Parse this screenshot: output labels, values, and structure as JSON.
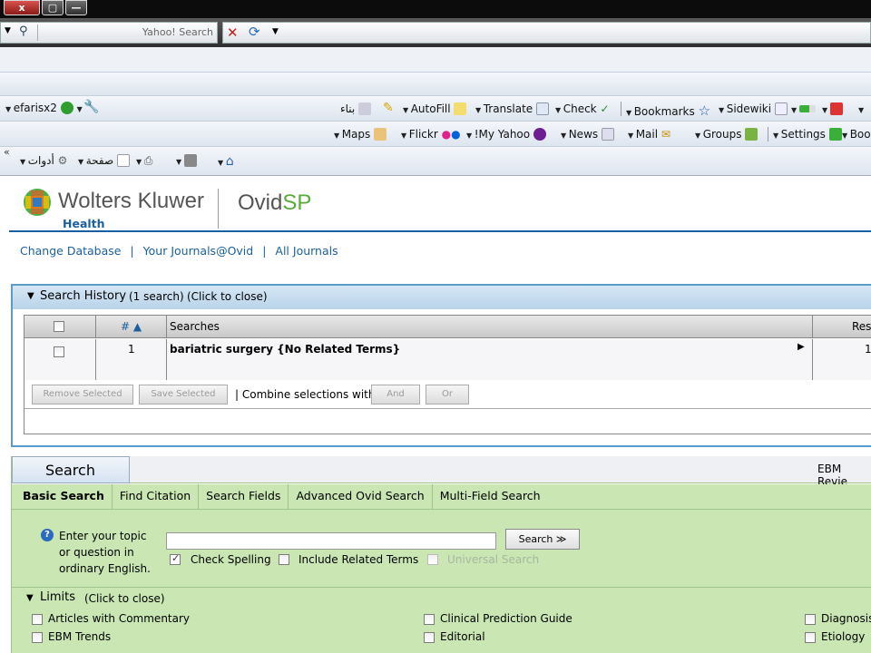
{
  "titlebar": {
    "buttons": [
      "x",
      "▢",
      "—"
    ]
  },
  "browser": {
    "search_box_placeholder": "Yahoo! Search",
    "toolbar2": {
      "user": "efarisx2",
      "arabic_build": "بناء",
      "autofill": "AutoFill",
      "translate": "Translate",
      "check": "Check",
      "bookmarks": "Bookmarks",
      "sidewiki": "Sidewiki"
    },
    "toolbar3": {
      "maps": "Maps",
      "flickr": "Flickr",
      "myyahoo": "!My Yahoo",
      "news": "News",
      "mail": "Mail",
      "groups": "Groups",
      "settings": "Settings",
      "boo": "Boo"
    },
    "toolbar4": {
      "chevrons": "«",
      "tools": "أدوات",
      "page": "صفحة"
    }
  },
  "brand": {
    "company": "Wolters Kluwer",
    "division": "Health",
    "product_a": "Ovid",
    "product_b": "SP"
  },
  "nav_links": [
    "Change Database",
    "Your Journals@Ovid",
    "All Journals"
  ],
  "search_history": {
    "title": "Search History",
    "count_text": "(1 search)",
    "close_text": "(Click to close)",
    "columns": {
      "num": "# ▲",
      "searches": "Searches",
      "results": "Resu"
    },
    "rows": [
      {
        "num": "1",
        "search": "bariatric surgery {No Related Terms}",
        "results": "1"
      }
    ],
    "remove_label": "Remove Selected",
    "save_label": "Save Selected",
    "combine_label": "| Combine selections with:",
    "and_label": "And",
    "or_label": "Or"
  },
  "search_panel": {
    "title": "Search",
    "db_label": "EBM Revie",
    "tabs": [
      "Basic Search",
      "Find Citation",
      "Search Fields",
      "Advanced Ovid Search",
      "Multi-Field Search"
    ],
    "help_text_1": "Enter your topic",
    "help_text_2": "or question in",
    "help_text_3": "ordinary English.",
    "search_button": "Search ≫",
    "check_spelling": "Check Spelling",
    "include_related": "Include Related Terms",
    "universal": "Universal Search"
  },
  "limits": {
    "title": "Limits",
    "close_text": "(Click to close)",
    "col1": [
      "Articles with Commentary",
      "EBM Trends"
    ],
    "col2": [
      "Clinical Prediction Guide",
      "Editorial"
    ],
    "col3": [
      "Diagnosis",
      "Etiology"
    ]
  },
  "colors": {
    "accent_blue": "#1a5f9f",
    "panel_green": "#c9e6b3",
    "header_blue": "#b9d3ea"
  }
}
